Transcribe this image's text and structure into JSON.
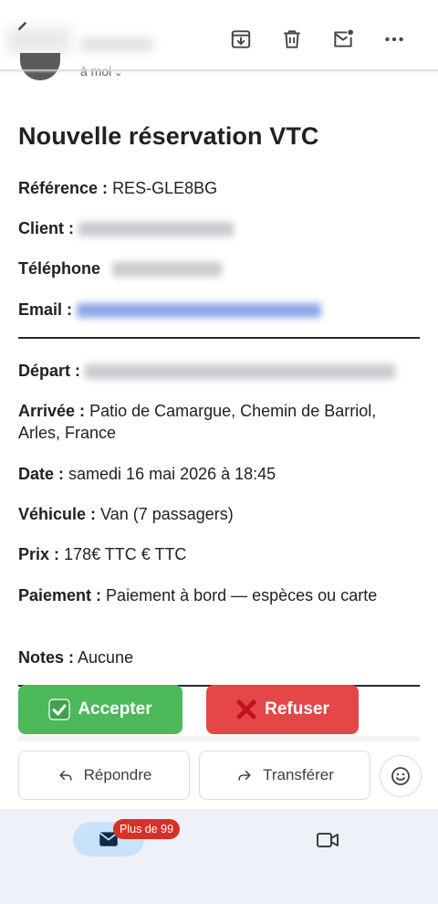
{
  "header": {
    "recipient_label": "à moi",
    "icons": [
      "back-arrow-icon",
      "archive-icon",
      "delete-icon",
      "mark-unread-icon",
      "more-icon"
    ]
  },
  "mail": {
    "title": "Nouvelle réservation VTC",
    "reference": {
      "label": "Référence :",
      "value": "RES-GLE8BG"
    },
    "client": {
      "label": "Client :"
    },
    "telephone": {
      "label": "Téléphone"
    },
    "email": {
      "label": "Email :"
    },
    "depart": {
      "label": "Départ :"
    },
    "arrivee": {
      "label": "Arrivée :",
      "value": "Patio de Camargue, Chemin de Barriol, Arles, France"
    },
    "date": {
      "label": "Date :",
      "value": "samedi 16 mai 2026 à 18:45"
    },
    "vehicule": {
      "label": "Véhicule :",
      "value": "Van (7 passagers)"
    },
    "prix": {
      "label": "Prix :",
      "value": "178€ TTC € TTC"
    },
    "paiement": {
      "label": "Paiement :",
      "value": "Paiement à bord — espèces ou carte"
    },
    "notes": {
      "label": "Notes :",
      "value": "Aucune"
    }
  },
  "actions": {
    "accept_label": "Accepter",
    "refuse_label": "Refuser",
    "accept_color": "#4cb95b",
    "refuse_color": "#e54648"
  },
  "reply": {
    "reply_label": "Répondre",
    "forward_label": "Transférer"
  },
  "bottom_nav": {
    "mail_badge": "Plus de 99",
    "icons": [
      "mail-icon",
      "video-icon"
    ]
  }
}
